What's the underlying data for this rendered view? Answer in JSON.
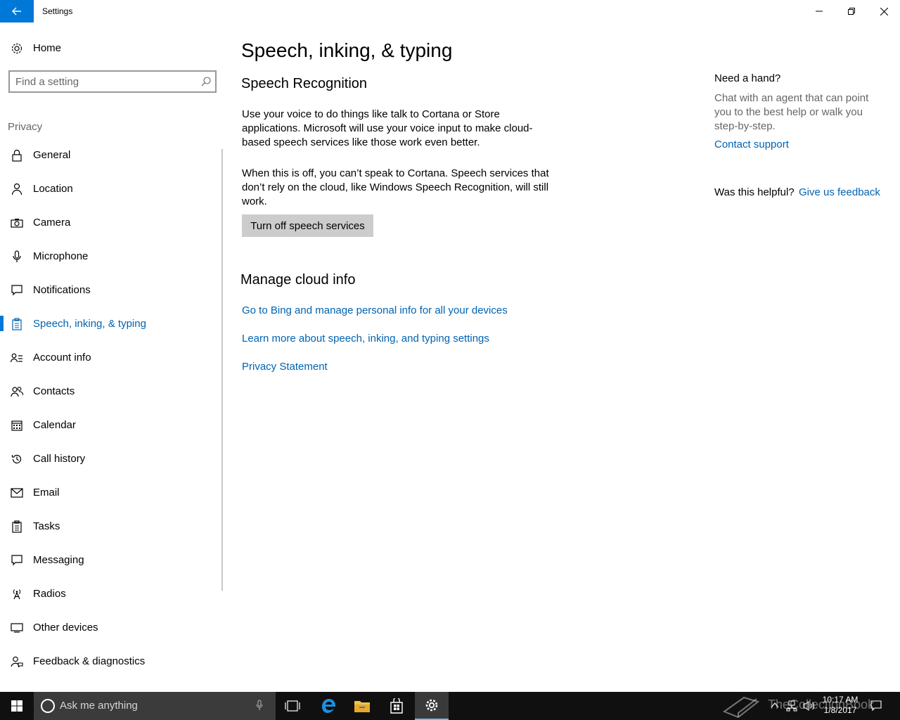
{
  "window": {
    "title": "Settings",
    "accent": "#0078d7",
    "link_color": "#0063b1"
  },
  "sidebar": {
    "home_label": "Home",
    "search_placeholder": "Find a setting",
    "section_title": "Privacy",
    "items": [
      {
        "label": "General",
        "icon": "lock-icon"
      },
      {
        "label": "Location",
        "icon": "person-icon"
      },
      {
        "label": "Camera",
        "icon": "camera-icon"
      },
      {
        "label": "Microphone",
        "icon": "microphone-icon"
      },
      {
        "label": "Notifications",
        "icon": "notification-icon"
      },
      {
        "label": "Speech, inking, & typing",
        "icon": "clipboard-icon",
        "active": true
      },
      {
        "label": "Account info",
        "icon": "account-info-icon"
      },
      {
        "label": "Contacts",
        "icon": "contacts-icon"
      },
      {
        "label": "Calendar",
        "icon": "calendar-icon"
      },
      {
        "label": "Call history",
        "icon": "history-icon"
      },
      {
        "label": "Email",
        "icon": "mail-icon"
      },
      {
        "label": "Tasks",
        "icon": "tasks-icon"
      },
      {
        "label": "Messaging",
        "icon": "message-icon"
      },
      {
        "label": "Radios",
        "icon": "radio-tower-icon"
      },
      {
        "label": "Other devices",
        "icon": "devices-icon"
      },
      {
        "label": "Feedback & diagnostics",
        "icon": "feedback-icon"
      }
    ]
  },
  "main": {
    "title": "Speech, inking, & typing",
    "speech_heading": "Speech Recognition",
    "speech_para1": "Use your voice to do things like talk to Cortana or Store applications. Microsoft will use your voice input to make cloud-based speech services like those work even better.",
    "speech_para2": "When this is off, you can’t speak to Cortana. Speech services that don’t rely on the cloud, like Windows Speech Recognition, will still work.",
    "speech_button": "Turn off speech services",
    "cloud_heading": "Manage cloud info",
    "links": [
      "Go to Bing and manage personal info for all your devices",
      "Learn more about speech, inking, and typing settings",
      "Privacy Statement"
    ]
  },
  "help": {
    "title": "Need a hand?",
    "text": "Chat with an agent that can point you to the best help or walk you step-by-step.",
    "contact_link": "Contact support",
    "helpful_label": "Was this helpful?",
    "feedback_link": "Give us feedback"
  },
  "taskbar": {
    "search_placeholder": "Ask me anything",
    "time": "10:17 AM",
    "date": "1/8/2017",
    "watermark": "TheCollectionBook"
  }
}
